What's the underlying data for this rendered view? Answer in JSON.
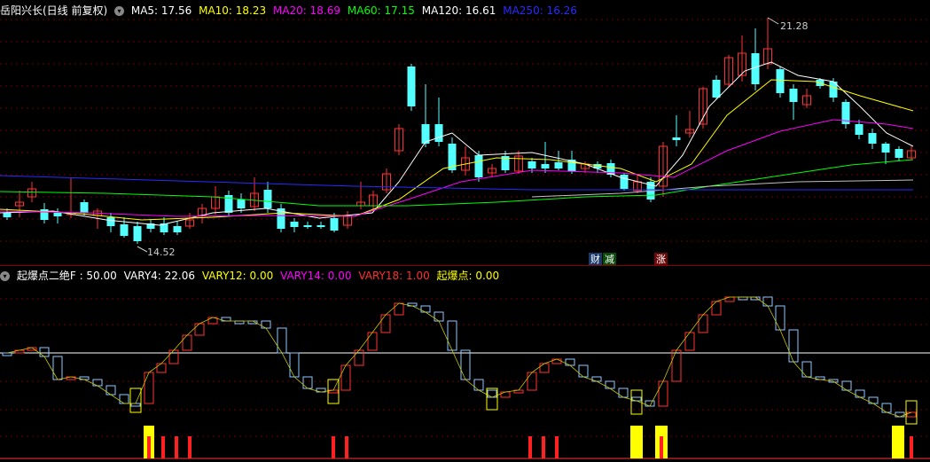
{
  "main_pane": {
    "title": "岳阳兴长(日线 前复权)",
    "dropdown_icon": "chevron-down-icon",
    "indicators": [
      {
        "label": "MA5: 17.56",
        "color": "#ffffff"
      },
      {
        "label": "MA10: 18.23",
        "color": "#ffff00"
      },
      {
        "label": "MA20: 18.69",
        "color": "#ff00ff"
      },
      {
        "label": "MA60: 17.15",
        "color": "#00ff00"
      },
      {
        "label": "MA120: 16.61",
        "color": "#ffffff"
      },
      {
        "label": "MA250: 16.26",
        "color": "#2a2aff"
      }
    ],
    "high_label": "21.28",
    "low_label": "14.52",
    "signals": [
      {
        "text": "财",
        "bg": "#1a3a6a",
        "color": "#ffffff"
      },
      {
        "text": "减",
        "bg": "#0a4a0a",
        "color": "#ffffff"
      },
      {
        "text": "涨",
        "bg": "#6a0a0a",
        "color": "#ffffff"
      }
    ]
  },
  "sub_pane": {
    "title": "起爆点二绝F",
    "indicators": [
      {
        "label": ": 50.00",
        "color": "#ffffff"
      },
      {
        "label": "VARY4: 22.06",
        "color": "#ffffff"
      },
      {
        "label": "VARY12: 0.00",
        "color": "#ffff00"
      },
      {
        "label": "VARY14: 0.00",
        "color": "#ff00ff"
      },
      {
        "label": "VARY18: 1.00",
        "color": "#ff3030"
      },
      {
        "label": "起爆点: 0.00",
        "color": "#ffff00"
      }
    ]
  },
  "colors": {
    "up": "#ff3232",
    "down": "#54ffff",
    "grid": "#7a0000"
  }
}
